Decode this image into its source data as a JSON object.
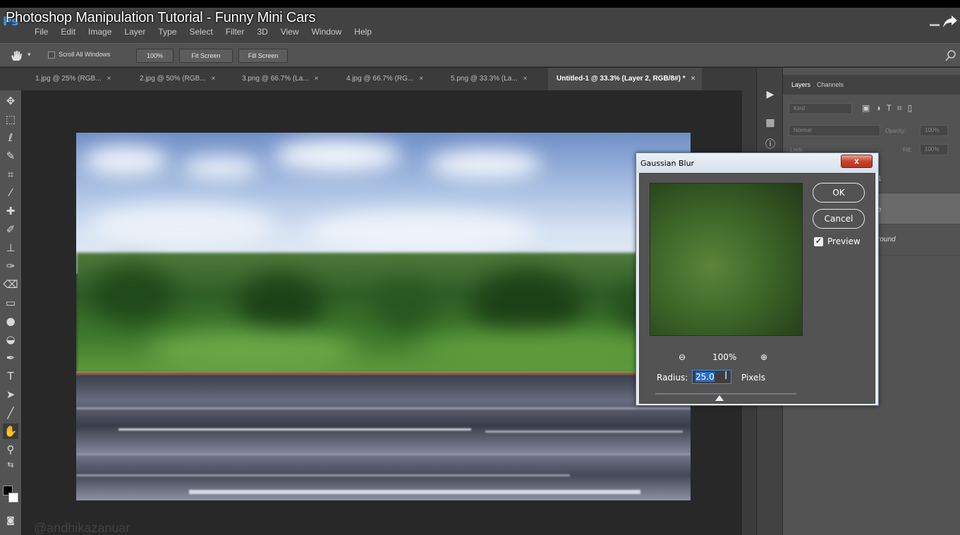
{
  "video": {
    "title": "Photoshop Manipulation Tutorial - Funny Mini Cars"
  },
  "app": {
    "logo": "Ps"
  },
  "menu": [
    "File",
    "Edit",
    "Image",
    "Layer",
    "Type",
    "Select",
    "Filter",
    "3D",
    "View",
    "Window",
    "Help"
  ],
  "options": {
    "scroll_all_label": "Scroll All Windows",
    "zoom_btn": "100%",
    "fit_btn": "Fit Screen",
    "fill_btn": "Fill Screen"
  },
  "tabs": [
    {
      "label": "1.jpg @ 25% (RGB...",
      "close": "×"
    },
    {
      "label": "2.jpg @ 50% (RGB...",
      "close": "×"
    },
    {
      "label": "3.png @ 66.7% (La...",
      "close": "×"
    },
    {
      "label": "4.jpg @ 66.7% (RG...",
      "close": "×"
    },
    {
      "label": "5.png @ 33.3% (La...",
      "close": "×"
    },
    {
      "label": "Untitled-1 @ 33.3% (Layer 2, RGB/8#) *",
      "close": "×"
    }
  ],
  "layers_panel": {
    "tab_layers": "Layers",
    "tab_channels": "Channels",
    "kind_placeholder": "Kind",
    "blend_mode": "Normal",
    "opacity_label": "Opacity:",
    "opacity_value": "100%",
    "lock_label": "Lock:",
    "fill_label": "Fill:",
    "fill_value": "100%",
    "layer_partial_1": "1",
    "layer_partial_2": "e",
    "layer_partial_3": "round"
  },
  "dialog": {
    "title": "Gaussian Blur",
    "close": "x",
    "ok": "OK",
    "cancel": "Cancel",
    "preview_label": "Preview",
    "preview_checked": true,
    "zoom_level": "100%",
    "radius_label": "Radius:",
    "radius_value": "25.0",
    "radius_unit": "Pixels"
  },
  "canvas": {
    "watermark": "@andhikazanuar"
  }
}
